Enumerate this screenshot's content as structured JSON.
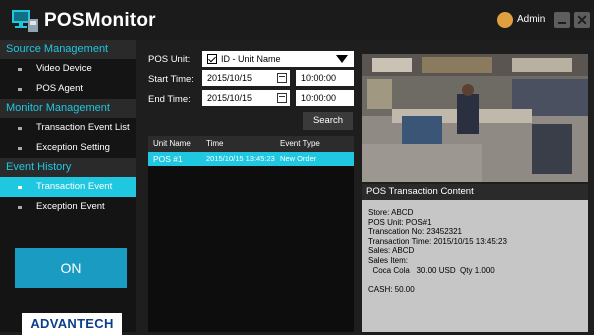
{
  "app": {
    "title": "POSMonitor",
    "user": "Admin"
  },
  "sidebar": {
    "sections": [
      {
        "title": "Source Management",
        "items": [
          "Video Device",
          "POS Agent"
        ]
      },
      {
        "title": "Monitor Management",
        "items": [
          "Transaction Event List",
          "Exception Setting"
        ]
      },
      {
        "title": "Event History",
        "items": [
          "Transaction Event",
          "Exception Event"
        ]
      }
    ],
    "active_item": "Transaction Event",
    "on_button": "ON",
    "brand": "ADVANTECH"
  },
  "form": {
    "pos_unit_label": "POS Unit:",
    "pos_unit_value": "ID - Unit Name",
    "start_label": "Start Time:",
    "start_date": "2015/10/15",
    "start_time": "10:00:00",
    "end_label": "End Time:",
    "end_date": "2015/10/15",
    "end_time": "10:00:00",
    "search": "Search"
  },
  "table": {
    "headers": [
      "Unit Name",
      "Time",
      "Event Type"
    ],
    "rows": [
      [
        "POS #1",
        "2015/10/15 13:45:23",
        "New Order"
      ]
    ]
  },
  "content": {
    "title": "POS Transaction Content",
    "lines": [
      "Store: ABCD",
      "POS Unit: POS#1",
      "Transcation No: 23452321",
      "Transaction Time: 2015/10/15 13:45:23",
      "Sales: ABCD",
      "Sales Item:",
      "  Coca Cola   30.00 USD  Qty 1.000",
      "",
      "CASH: 50.00"
    ]
  },
  "colors": {
    "accent": "#1fc7e0",
    "on_button": "#1a9cc2",
    "brand_text": "#0b3f8b"
  },
  "icons": [
    "monitor-logo-icon",
    "user-icon",
    "minimize-icon",
    "close-icon",
    "calendar-icon",
    "dropdown-arrow-icon",
    "checkbox-icon"
  ]
}
